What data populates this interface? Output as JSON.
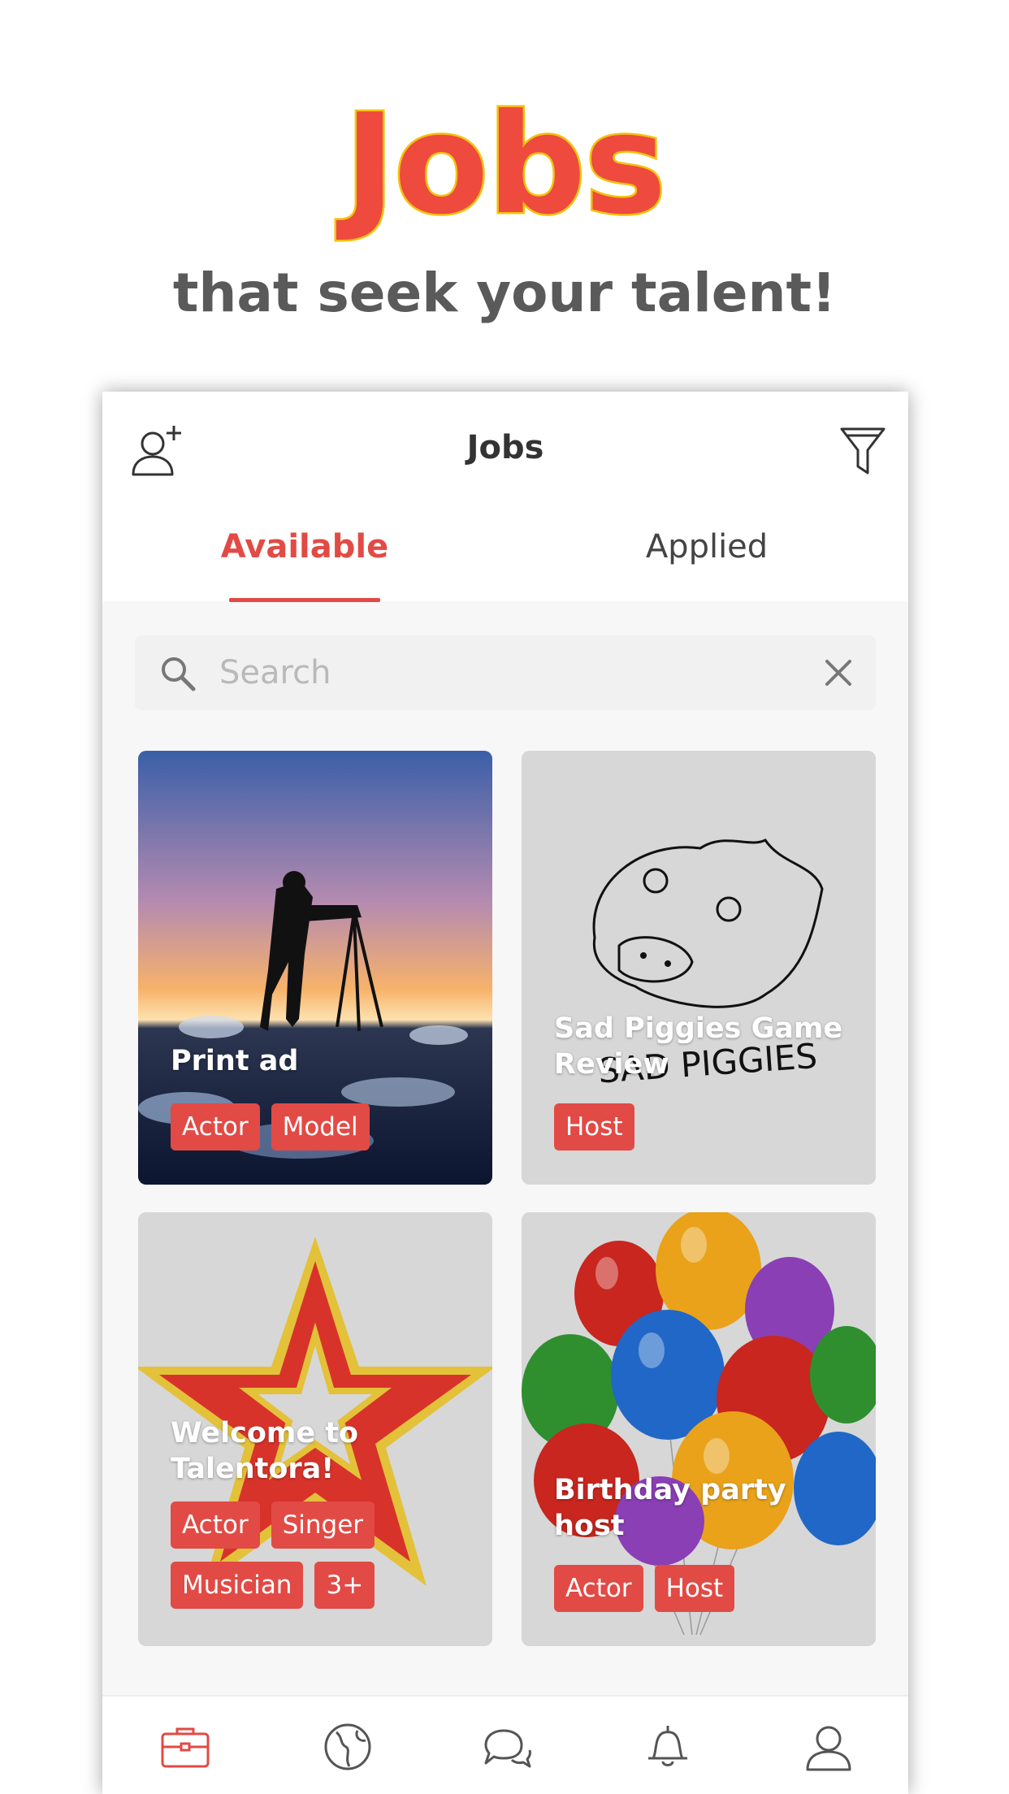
{
  "promo": {
    "title": "Jobs",
    "subtitle": "that seek your talent!"
  },
  "header": {
    "title": "Jobs",
    "left_icon": "add-user-icon",
    "right_icon": "filter-icon"
  },
  "tabs": [
    {
      "label": "Available",
      "active": true
    },
    {
      "label": "Applied",
      "active": false
    }
  ],
  "search": {
    "placeholder": "Search",
    "value": ""
  },
  "jobs": [
    {
      "title": "Print ad",
      "tags": [
        "Actor",
        "Model"
      ]
    },
    {
      "title": "Sad Piggies Game Review",
      "tags": [
        "Host"
      ],
      "image_text": "SAD PIGGIES"
    },
    {
      "title": "Welcome to Talentora!",
      "tags": [
        "Actor",
        "Singer",
        "Musician",
        "3+"
      ]
    },
    {
      "title": "Birthday party host",
      "tags": [
        "Actor",
        "Host"
      ]
    }
  ],
  "tab_bar": [
    {
      "icon": "briefcase-icon",
      "active": true
    },
    {
      "icon": "globe-icon",
      "active": false
    },
    {
      "icon": "chat-icon",
      "active": false
    },
    {
      "icon": "bell-icon",
      "active": false
    },
    {
      "icon": "profile-icon",
      "active": false
    }
  ],
  "colors": {
    "accent": "#e24a45",
    "promo_title": "#ee4a3e",
    "promo_outline": "#f4c20d"
  }
}
